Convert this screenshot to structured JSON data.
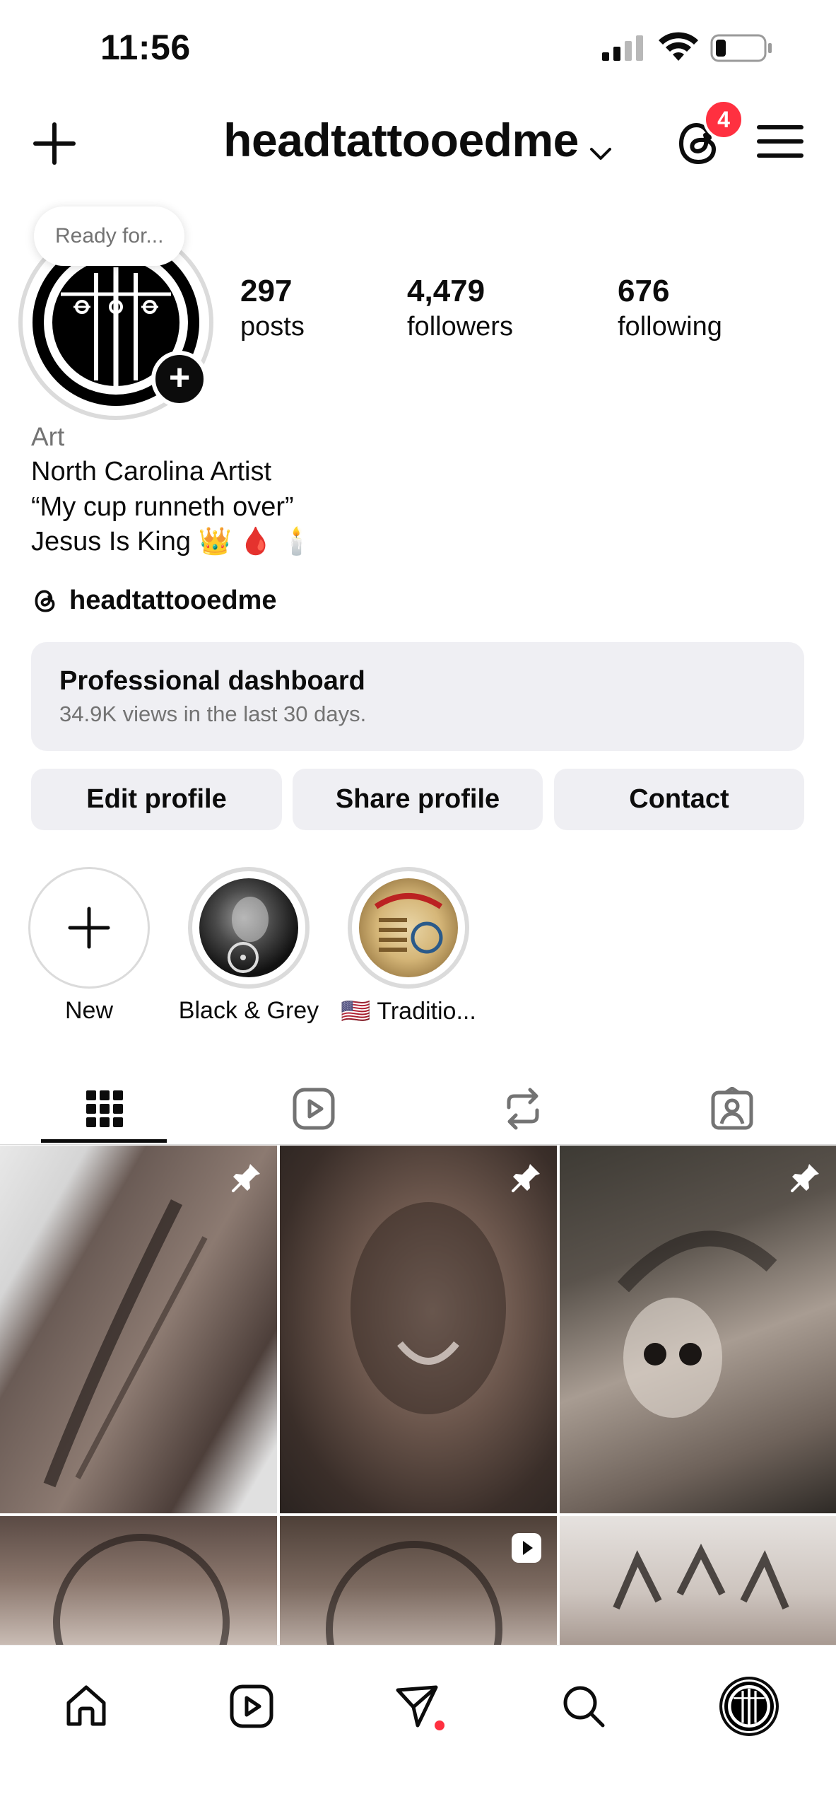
{
  "status_bar": {
    "time": "11:56"
  },
  "header": {
    "username": "headtattooedme",
    "notification_count": "4"
  },
  "profile": {
    "note": "Ready for...",
    "stats": {
      "posts": {
        "count": "297",
        "label": "posts"
      },
      "followers": {
        "count": "4,479",
        "label": "followers"
      },
      "following": {
        "count": "676",
        "label": "following"
      }
    },
    "category": "Art",
    "bio": [
      "North Carolina Artist",
      "“My cup runneth over”",
      "Jesus Is King 👑 🩸 🕯️"
    ],
    "threads_handle": "headtattooedme"
  },
  "dashboard": {
    "title": "Professional dashboard",
    "subtitle": "34.9K views in the last 30 days."
  },
  "actions": {
    "edit": "Edit profile",
    "share": "Share profile",
    "contact": "Contact"
  },
  "highlights": [
    {
      "label": "New"
    },
    {
      "label": "Black & Grey"
    },
    {
      "label": "🇺🇸 Traditio..."
    }
  ],
  "tabs": [
    "grid-icon",
    "reels-icon",
    "reposts-icon",
    "tagged-icon"
  ],
  "posts": [
    {
      "pinned": true,
      "type": "photo",
      "subject": "script tattoo"
    },
    {
      "pinned": true,
      "type": "photo",
      "subject": "lion tattoo"
    },
    {
      "pinned": true,
      "type": "photo",
      "subject": "skull headdress tattoo"
    },
    {
      "pinned": false,
      "type": "photo",
      "subject": "clock tattoo"
    },
    {
      "pinned": false,
      "type": "reel",
      "subject": "clock tattoo"
    },
    {
      "pinned": false,
      "type": "photo",
      "subject": "tattoo"
    }
  ],
  "bottom_nav": [
    "home-icon",
    "reels-icon",
    "messages-icon",
    "search-icon",
    "profile-avatar"
  ],
  "colors": {
    "badge": "#ff3040",
    "surface": "#efeff3",
    "text_secondary": "#737373"
  }
}
